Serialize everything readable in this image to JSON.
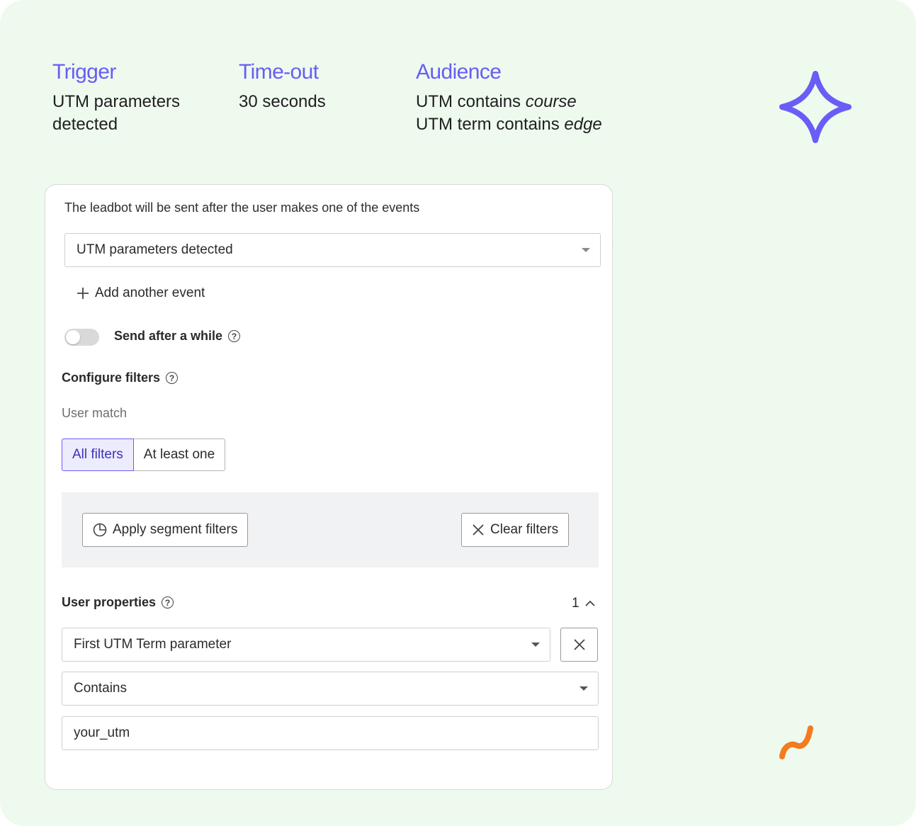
{
  "info": {
    "trigger": {
      "title": "Trigger",
      "lines": [
        "UTM parameters",
        "detected"
      ]
    },
    "timeout": {
      "title": "Time-out",
      "text": "30 seconds"
    },
    "audience": {
      "title": "Audience",
      "line1": {
        "prefix": "UTM contains ",
        "value": "course"
      },
      "line2": {
        "prefix": "UTM term contains ",
        "value": "edge"
      }
    }
  },
  "panel": {
    "intro": "The leadbot will be sent after the user makes one of the events",
    "event_select": {
      "value": "UTM parameters detected"
    },
    "add_event_label": "Add another event",
    "send_after_label": "Send after a while",
    "send_after_enabled": false,
    "configure_filters_label": "Configure filters",
    "user_match_label": "User match",
    "match_options": [
      "All filters",
      "At least one"
    ],
    "match_selected": "All filters",
    "apply_segment_label": "Apply segment filters",
    "clear_filters_label": "Clear filters",
    "user_properties_label": "User properties",
    "user_properties_count": "1",
    "property_select": {
      "value": "First UTM Term parameter"
    },
    "operator_select": {
      "value": "Contains"
    },
    "value_input": {
      "value": "your_utm"
    }
  },
  "icons": [
    "star-icon",
    "squiggle-icon",
    "plus-icon",
    "help-icon",
    "pie-chart-icon",
    "close-icon",
    "chevron-up-icon",
    "caret-down-icon"
  ],
  "colors": {
    "background": "#eefaee",
    "accent": "#6a5cf6",
    "squiggle": "#f47b20"
  }
}
